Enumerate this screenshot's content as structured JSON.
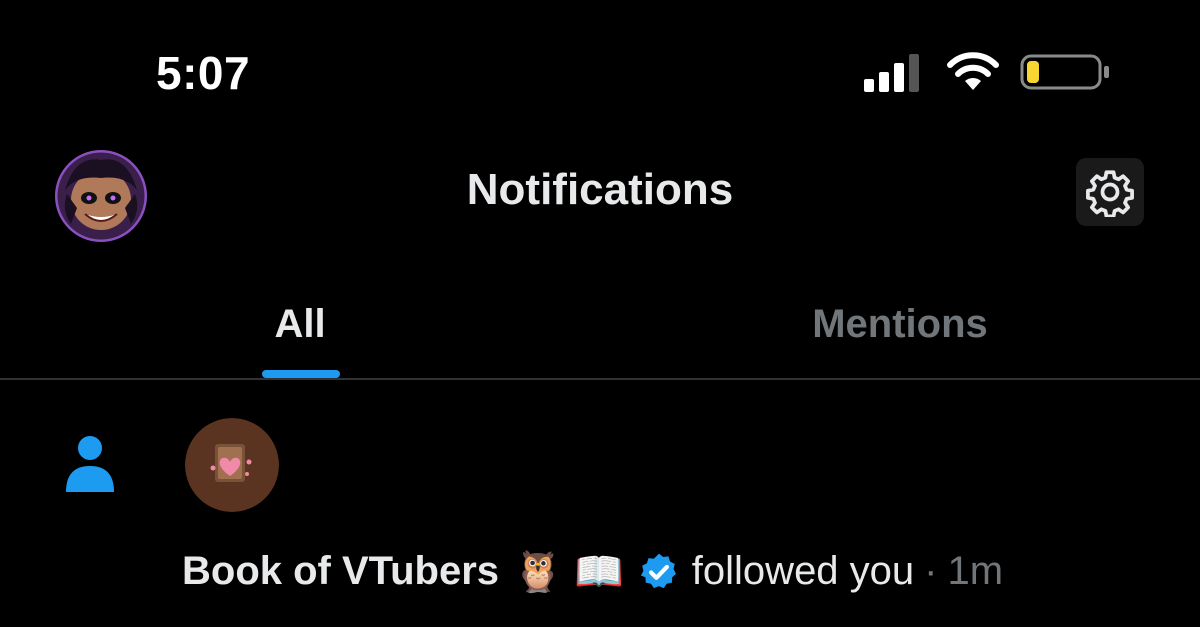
{
  "status_bar": {
    "time": "5:07",
    "signal_bars": 3,
    "battery_level": 0.15,
    "battery_color": "#f7d631"
  },
  "header": {
    "title": "Notifications",
    "avatar_icon": "user-avatar",
    "settings_icon": "gear-icon"
  },
  "tabs": [
    {
      "label": "All",
      "active": true
    },
    {
      "label": "Mentions",
      "active": false
    }
  ],
  "colors": {
    "accent": "#1d9bf0",
    "background": "#000000",
    "text_primary": "#e7e9ea",
    "text_secondary": "#71767b"
  },
  "notification": {
    "type_icon": "person-icon",
    "user_name": "Book of VTubers",
    "name_emojis": "🦉 📖",
    "verified_icon": "verified-badge-icon",
    "action": "followed you",
    "separator": "·",
    "time": "1m"
  }
}
